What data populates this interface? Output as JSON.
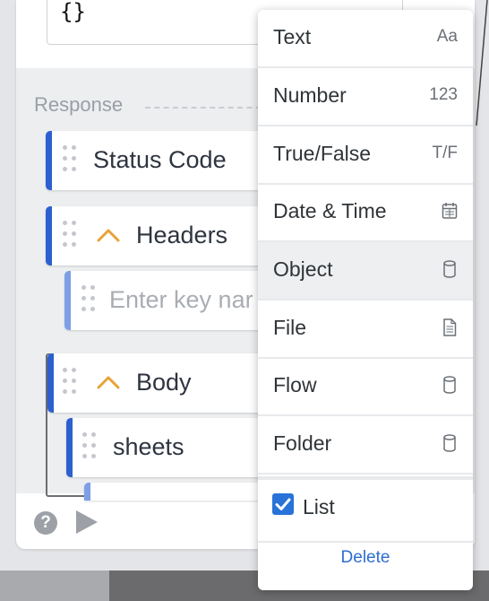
{
  "code_editor": {
    "text": "{}"
  },
  "response": {
    "section_label": "Response",
    "rows": {
      "status_code": "Status Code",
      "headers": "Headers",
      "key_placeholder": "Enter key nar",
      "body": "Body",
      "sheets": "sheets"
    }
  },
  "footer": {
    "help_glyph": "?"
  },
  "type_menu": {
    "items": [
      {
        "label": "Text",
        "hint": "Aa"
      },
      {
        "label": "Number",
        "hint": "123"
      },
      {
        "label": "True/False",
        "hint": "T/F"
      },
      {
        "label": "Date & Time",
        "icon": "calendar-icon"
      },
      {
        "label": "Object",
        "icon": "cylinder-icon"
      },
      {
        "label": "File",
        "icon": "file-icon"
      },
      {
        "label": "Flow",
        "icon": "cylinder-icon"
      },
      {
        "label": "Folder",
        "icon": "cylinder-icon"
      }
    ],
    "selected": "Object",
    "list_label": "List",
    "list_checked": true,
    "delete_label": "Delete"
  },
  "colors": {
    "accent": "#2d5fcf",
    "link": "#2d6ed2",
    "chevron": "#e8a23a"
  }
}
